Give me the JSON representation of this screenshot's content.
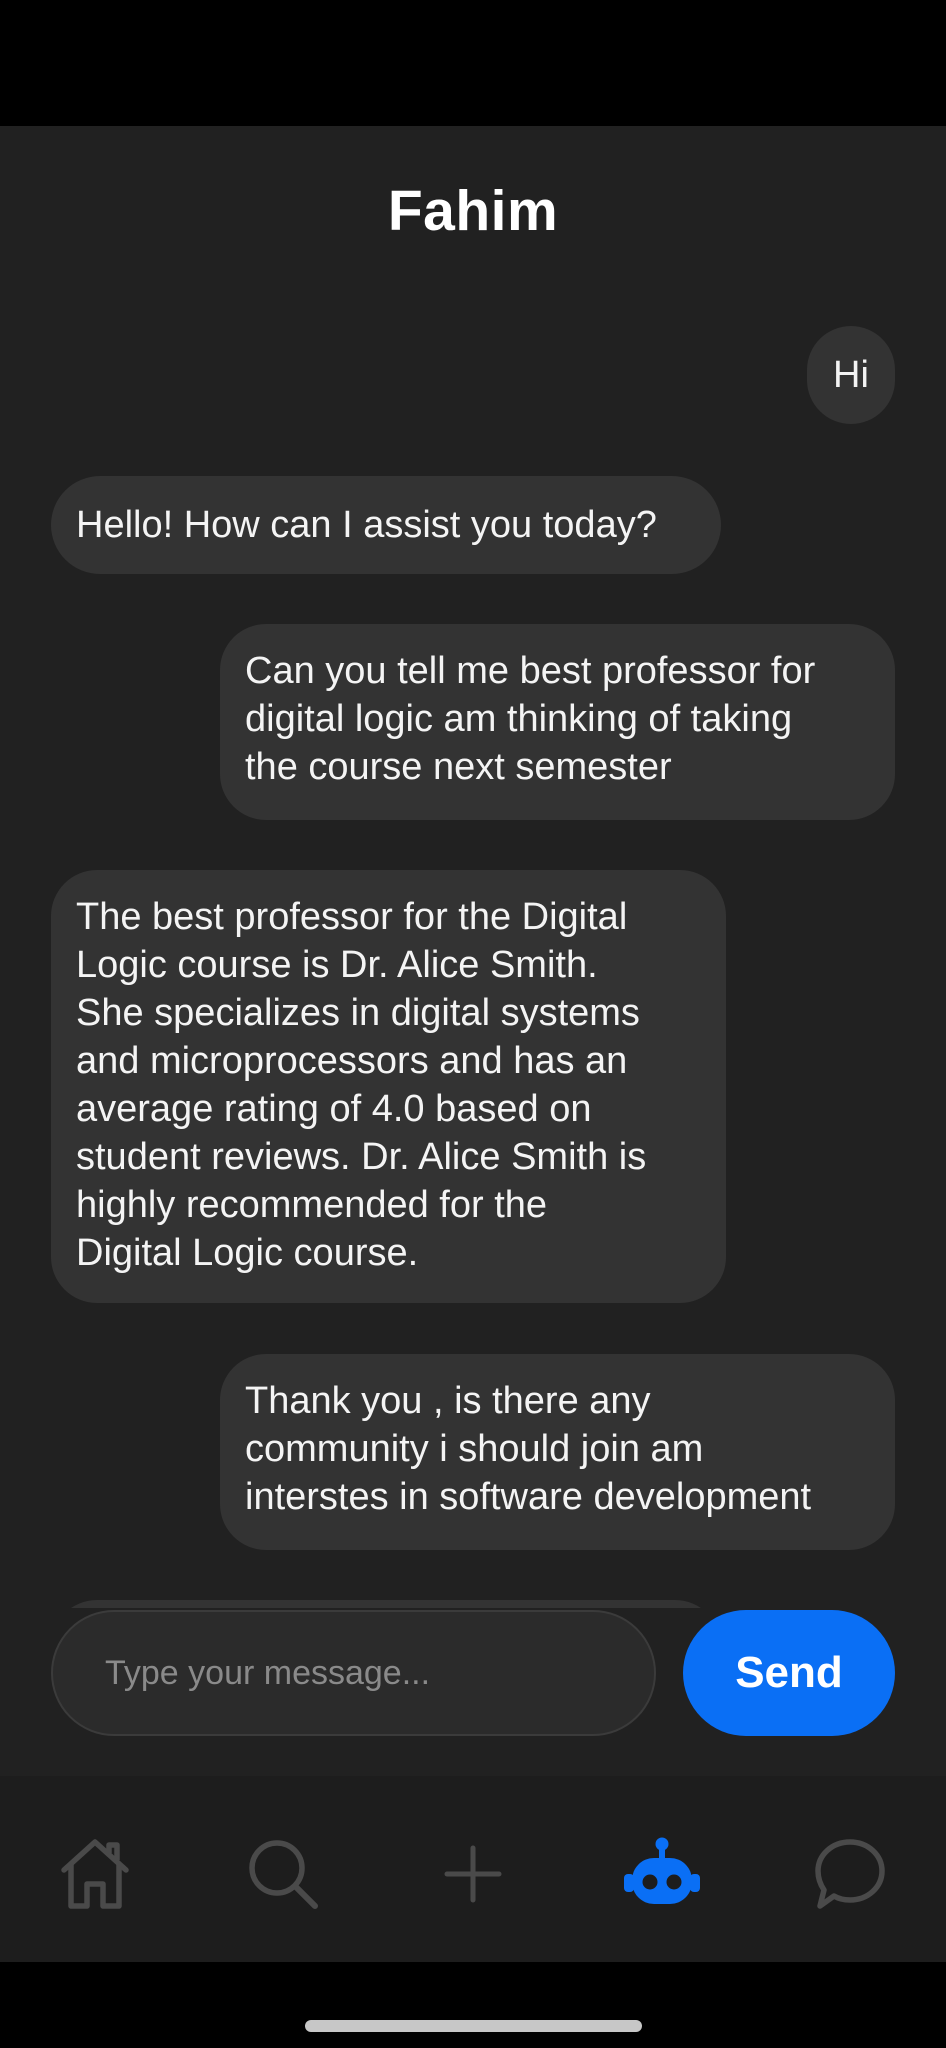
{
  "header": {
    "title": "Fahim"
  },
  "messages": [
    {
      "sender": "user",
      "text": "Hi"
    },
    {
      "sender": "bot",
      "text": "Hello! How can I assist you today?"
    },
    {
      "sender": "user",
      "lines": [
        "Can you tell me best professor for",
        "digital logic am thinking of taking",
        "the course next semester"
      ]
    },
    {
      "sender": "bot",
      "lines": [
        "The best professor for the Digital",
        "Logic course is Dr. Alice Smith.",
        "She specializes in digital systems",
        "and microprocessors and has an",
        "average rating of 4.0 based on",
        "student reviews. Dr. Alice Smith is",
        "highly recommended for the",
        "Digital Logic course."
      ]
    },
    {
      "sender": "user",
      "lines": [
        "Thank you , is there any",
        "community i should join am",
        "interstes in software development"
      ]
    }
  ],
  "composer": {
    "placeholder": "Type your message...",
    "value": "",
    "send_label": "Send"
  },
  "tabbar": {
    "active_color": "#0a6ff5",
    "inactive_color": "#4a4a4a",
    "items": [
      {
        "icon": "home-icon",
        "active": false
      },
      {
        "icon": "search-icon",
        "active": false
      },
      {
        "icon": "plus-icon",
        "active": false
      },
      {
        "icon": "robot-icon",
        "active": true
      },
      {
        "icon": "chat-bubble-icon",
        "active": false
      }
    ]
  }
}
